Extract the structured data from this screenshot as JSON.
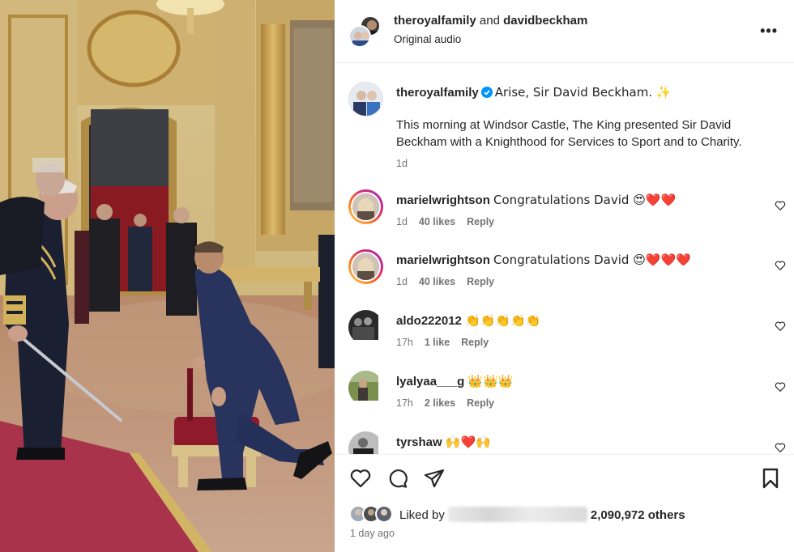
{
  "header": {
    "user1": "theroyalfamily",
    "and": "and",
    "user2": "davidbeckham",
    "audio": "Original audio",
    "more_icon": "more-horizontal-icon"
  },
  "caption": {
    "username": "theroyalfamily",
    "text1": "Arise, Sir David Beckham. ✨",
    "text2": "This morning at Windsor Castle, The King presented Sir David Beckham with a Knighthood for Services to Sport and to Charity.",
    "time": "1d"
  },
  "comments": [
    {
      "username": "marielwrightson",
      "text": "Congratulations David 😍❤️❤️",
      "time": "1d",
      "likes": "40 likes",
      "reply": "Reply"
    },
    {
      "username": "marielwrightson",
      "text": "Congratulations David 😍❤️❤️❤️",
      "time": "1d",
      "likes": "40 likes",
      "reply": "Reply"
    },
    {
      "username": "aldo222012",
      "text": "👏👏👏👏👏",
      "time": "17h",
      "likes": "1 like",
      "reply": "Reply"
    },
    {
      "username": "lyalyaa___g",
      "text": "👑👑👑",
      "time": "17h",
      "likes": "2 likes",
      "reply": "Reply"
    },
    {
      "username": "tyrshaw",
      "text": "🙌❤️🙌",
      "time": "",
      "likes": "",
      "reply": ""
    }
  ],
  "actions": {
    "liked_by": "Liked by",
    "others": "2,090,972 others",
    "time_ago": "1 day ago"
  },
  "colors": {
    "verified": "#0095f6",
    "muted": "#737373",
    "text": "#262626"
  }
}
